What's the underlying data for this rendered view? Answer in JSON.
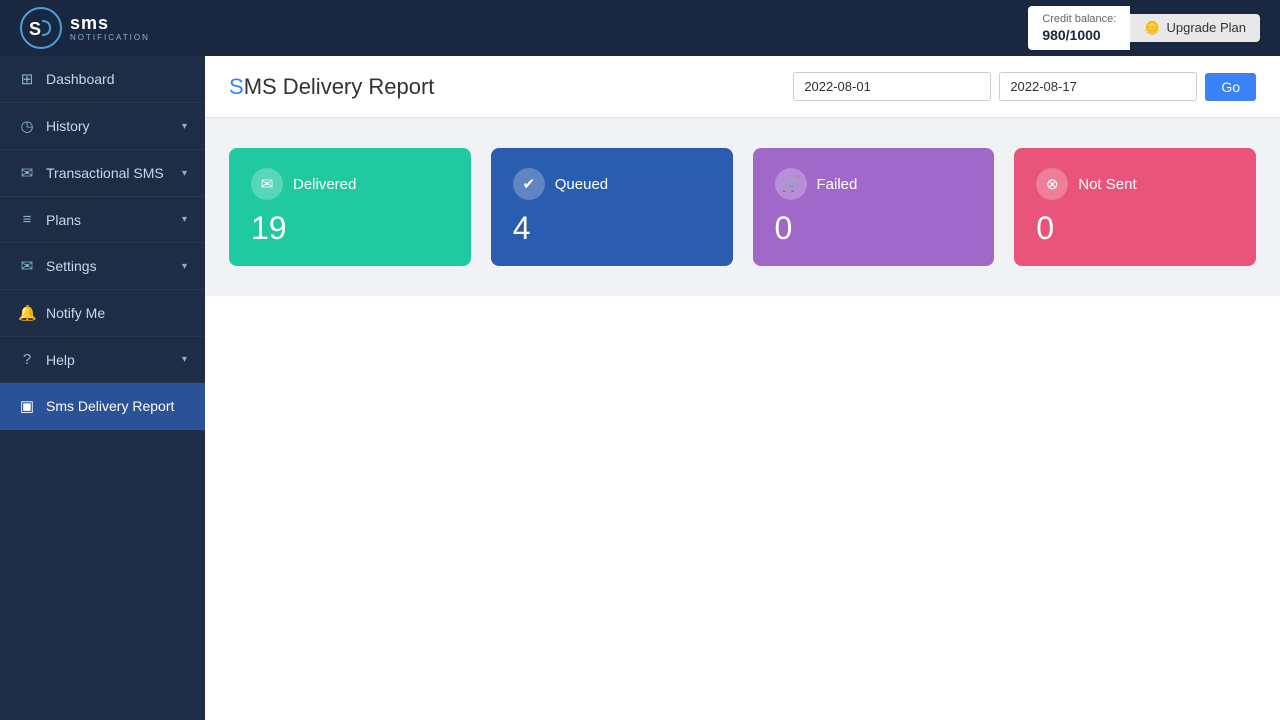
{
  "topbar": {
    "logo_s": "S",
    "logo_ms": "MS",
    "logo_sub": "NOTIFICATION",
    "credit_label": "Credit balance:",
    "credit_value": "980/1000",
    "upgrade_label": "Upgrade Plan"
  },
  "sidebar": {
    "items": [
      {
        "id": "dashboard",
        "label": "Dashboard",
        "icon": "⊞",
        "has_chevron": false,
        "active": false
      },
      {
        "id": "history",
        "label": "History",
        "icon": "◷",
        "has_chevron": true,
        "active": false
      },
      {
        "id": "transactional-sms",
        "label": "Transactional SMS",
        "icon": "✉",
        "has_chevron": true,
        "active": false
      },
      {
        "id": "plans",
        "label": "Plans",
        "icon": "≡",
        "has_chevron": true,
        "active": false
      },
      {
        "id": "settings",
        "label": "Settings",
        "icon": "✉",
        "has_chevron": true,
        "active": false
      },
      {
        "id": "notify-me",
        "label": "Notify Me",
        "icon": "🔔",
        "has_chevron": false,
        "active": false
      },
      {
        "id": "help",
        "label": "Help",
        "icon": "?",
        "has_chevron": true,
        "active": false
      },
      {
        "id": "sms-delivery-report",
        "label": "Sms Delivery Report",
        "icon": "▣",
        "has_chevron": false,
        "active": true
      }
    ]
  },
  "page": {
    "title_s": "S",
    "title_rest": "MS Delivery Report",
    "date_from": "2022-08-01",
    "date_to": "2022-08-17",
    "go_label": "Go"
  },
  "stats": [
    {
      "id": "delivered",
      "label": "Delivered",
      "value": "19",
      "icon": "✉",
      "color_class": "delivered"
    },
    {
      "id": "queued",
      "label": "Queued",
      "value": "4",
      "icon": "✔",
      "color_class": "queued"
    },
    {
      "id": "failed",
      "label": "Failed",
      "value": "0",
      "icon": "🛒",
      "color_class": "failed"
    },
    {
      "id": "not-sent",
      "label": "Not Sent",
      "value": "0",
      "icon": "⊗",
      "color_class": "not-sent"
    }
  ]
}
